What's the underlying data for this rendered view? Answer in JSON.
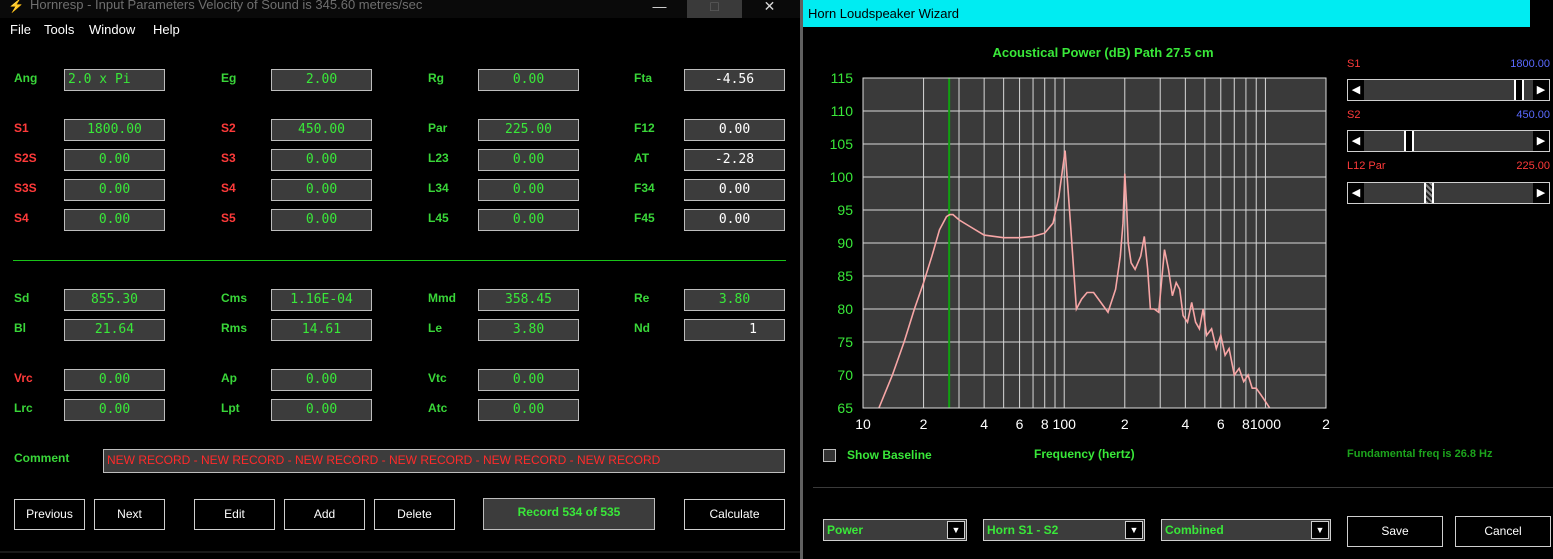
{
  "left_window": {
    "title": "Hornresp - Input Parameters   Velocity of Sound is 345.60 metres/sec",
    "controls": {
      "minimize": "—",
      "maximize": "□",
      "close": "✕"
    },
    "menu": [
      "File",
      "Tools",
      "Window",
      "Help"
    ],
    "params": {
      "ang": {
        "label": "Ang",
        "value": "2.0 x Pi"
      },
      "eg": {
        "label": "Eg",
        "value": "2.00"
      },
      "rg": {
        "label": "Rg",
        "value": "0.00"
      },
      "fta": {
        "label": "Fta",
        "value": "-4.56"
      },
      "s1": {
        "label": "S1",
        "value": "1800.00"
      },
      "s2": {
        "label": "S2",
        "value": "450.00"
      },
      "par": {
        "label": "Par",
        "value": "225.00"
      },
      "f12": {
        "label": "F12",
        "value": "0.00"
      },
      "s2s": {
        "label": "S2S",
        "value": "0.00"
      },
      "s3": {
        "label": "S3",
        "value": "0.00"
      },
      "l23": {
        "label": "L23",
        "value": "0.00"
      },
      "at": {
        "label": "AT",
        "value": "-2.28"
      },
      "s3s": {
        "label": "S3S",
        "value": "0.00"
      },
      "s4": {
        "label": "S4",
        "value": "0.00"
      },
      "l34": {
        "label": "L34",
        "value": "0.00"
      },
      "f34": {
        "label": "F34",
        "value": "0.00"
      },
      "s4b": {
        "label": "S4",
        "value": "0.00"
      },
      "s5": {
        "label": "S5",
        "value": "0.00"
      },
      "l45": {
        "label": "L45",
        "value": "0.00"
      },
      "f45": {
        "label": "F45",
        "value": "0.00"
      },
      "sd": {
        "label": "Sd",
        "value": "855.30"
      },
      "cms": {
        "label": "Cms",
        "value": "1.16E-04"
      },
      "mmd": {
        "label": "Mmd",
        "value": "358.45"
      },
      "re": {
        "label": "Re",
        "value": "3.80"
      },
      "bl": {
        "label": "Bl",
        "value": "21.64"
      },
      "rms": {
        "label": "Rms",
        "value": "14.61"
      },
      "le": {
        "label": "Le",
        "value": "3.80"
      },
      "nd": {
        "label": "Nd",
        "value": "1"
      },
      "vrc": {
        "label": "Vrc",
        "value": "0.00"
      },
      "ap": {
        "label": "Ap",
        "value": "0.00"
      },
      "vtc": {
        "label": "Vtc",
        "value": "0.00"
      },
      "lrc": {
        "label": "Lrc",
        "value": "0.00"
      },
      "lpt": {
        "label": "Lpt",
        "value": "0.00"
      },
      "atc": {
        "label": "Atc",
        "value": "0.00"
      }
    },
    "comment": {
      "label": "Comment",
      "value": "NEW RECORD - NEW RECORD - NEW RECORD - NEW RECORD - NEW RECORD - NEW RECORD"
    },
    "buttons": {
      "previous": "Previous",
      "next": "Next",
      "edit": "Edit",
      "add": "Add",
      "delete": "Delete",
      "record": "Record 534 of 535",
      "calculate": "Calculate"
    },
    "colors": {
      "value_green": "#39e839",
      "label_green": "#39d639",
      "label_red": "#ff3a3a"
    }
  },
  "right_window": {
    "title": "Horn Loudspeaker Wizard",
    "chart_header": "Acoustical Power (dB)   Path 27.5 cm",
    "sliders": [
      {
        "label": "S1",
        "value": "1800.00",
        "label_color": "#ff3a3a",
        "value_color": "#5a6aff",
        "position": 0.93
      },
      {
        "label": "S2",
        "value": "450.00",
        "label_color": "#ff3a3a",
        "value_color": "#5a6aff",
        "position": 0.25
      },
      {
        "label": "L12  Par",
        "value": "225.00",
        "label_color": "#ff3a3a",
        "value_color": "#ff3a3a",
        "position": 0.37
      }
    ],
    "show_baseline": {
      "label": "Show Baseline",
      "checked": false
    },
    "fundamental": "Fundamental freq is 26.8 Hz",
    "dropdowns": {
      "mode": "Power",
      "horn": "Horn S1 - S2",
      "view": "Combined"
    },
    "buttons": {
      "save": "Save",
      "cancel": "Cancel"
    }
  },
  "chart_data": {
    "type": "line",
    "scale_x": "log",
    "xlabel": "Frequency (hertz)",
    "ylabel": "",
    "xlim": [
      10,
      2000
    ],
    "ylim": [
      65,
      115
    ],
    "yticks": [
      65,
      70,
      75,
      80,
      85,
      90,
      95,
      100,
      105,
      110,
      115
    ],
    "xtick_labels": [
      {
        "value": 10,
        "label": "10"
      },
      {
        "value": 20,
        "label": "2"
      },
      {
        "value": 40,
        "label": "4"
      },
      {
        "value": 60,
        "label": "6"
      },
      {
        "value": 80,
        "label": "8"
      },
      {
        "value": 100,
        "label": "100"
      },
      {
        "value": 200,
        "label": "2"
      },
      {
        "value": 400,
        "label": "4"
      },
      {
        "value": 600,
        "label": "6"
      },
      {
        "value": 800,
        "label": "8"
      },
      {
        "value": 1000,
        "label": "1000"
      },
      {
        "value": 2000,
        "label": "2"
      }
    ],
    "grid": true,
    "marker_line": {
      "x": 26.8,
      "color": "#10a010"
    },
    "series": [
      {
        "color": "#f7a6a6",
        "x": [
          12,
          14,
          16,
          18,
          20,
          22,
          24,
          26,
          27,
          28,
          30,
          34,
          40,
          50,
          60,
          70,
          80,
          88,
          94,
          98,
          101,
          104,
          108,
          115,
          122,
          130,
          140,
          152,
          165,
          180,
          190,
          196,
          200,
          204,
          208,
          215,
          225,
          240,
          250,
          260,
          268,
          280,
          295,
          315,
          330,
          345,
          360,
          375,
          390,
          410,
          430,
          450,
          470,
          490,
          510,
          540,
          570,
          600,
          630,
          660,
          700,
          740,
          780,
          820,
          860,
          900,
          950,
          1000,
          1050
        ],
        "y": [
          65,
          70,
          75,
          80,
          84,
          88,
          92,
          94,
          94.3,
          94.3,
          93.5,
          92.5,
          91.2,
          90.8,
          90.8,
          91.0,
          91.5,
          93,
          97,
          101,
          104,
          99,
          92,
          80,
          81.5,
          82.5,
          82.5,
          81,
          79.5,
          83,
          88,
          93,
          100.5,
          96,
          90,
          87,
          86,
          88,
          91,
          86,
          80,
          80,
          79.5,
          89,
          86,
          82,
          84,
          83,
          79,
          78,
          81,
          78,
          77,
          80,
          76,
          77,
          74,
          76,
          73,
          74,
          70,
          71,
          69,
          70,
          68,
          68,
          67,
          66,
          65
        ]
      }
    ]
  }
}
